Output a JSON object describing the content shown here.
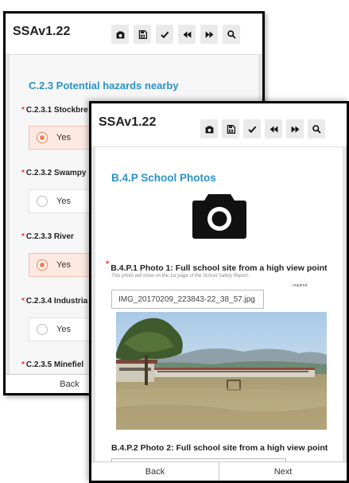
{
  "back_screen": {
    "title": "SSAv1.22",
    "section_title": "C.2.3 Potential hazards nearby",
    "questions": [
      {
        "label": "C.2.3.1 Stockbre",
        "option": "Yes",
        "selected": true
      },
      {
        "label": "C.2.3.2 Swampy",
        "option": "Yes",
        "selected": false
      },
      {
        "label": "C.2.3.3 River",
        "option": "Yes",
        "selected": true
      },
      {
        "label": "C.2.3.4 Industria",
        "option": "Yes",
        "selected": false
      },
      {
        "label": "C.2.3.5 Minefiel",
        "option": null,
        "selected": false
      }
    ],
    "nav": {
      "back": "Back"
    }
  },
  "front_screen": {
    "title": "SSAv1.22",
    "section_title": "B.4.P School Photos",
    "photo1": {
      "label": "B.4.P.1 Photo 1: Full school site from a high view point",
      "help": "This photo will show on the 1st page of the School Safety Report.",
      "required": "required",
      "filename": "IMG_20170209_223843-22_38_57.jpg"
    },
    "photo2": {
      "label": "B.4.P.2 Photo 2: Full school site from a high view point"
    },
    "nav": {
      "back": "Back",
      "next": "Next"
    }
  },
  "required_mark": "*",
  "toolbar_icons": [
    "camera-icon",
    "save-icon",
    "check-icon",
    "rewind-icon",
    "fast-forward-icon",
    "search-icon"
  ],
  "colors": {
    "accent": "#e53935",
    "section": "#2b93c9",
    "selected_bg": "#fde8e2",
    "radio": "#f47c4c"
  }
}
